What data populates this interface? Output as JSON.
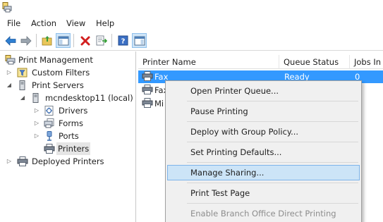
{
  "window": {
    "app_icon": "printer-management-icon"
  },
  "menubar": {
    "items": [
      "File",
      "Action",
      "View",
      "Help"
    ]
  },
  "toolbar": {
    "buttons": [
      "back-icon",
      "forward-icon",
      "up-folder-icon",
      "show-hide-console-tree-icon",
      "delete-icon",
      "export-list-icon",
      "help-icon",
      "show-hide-action-pane-icon"
    ]
  },
  "tree": {
    "root": "Print Management",
    "custom_filters": "Custom Filters",
    "print_servers": "Print Servers",
    "server": "mcndesktop11 (local)",
    "drivers": "Drivers",
    "forms": "Forms",
    "ports": "Ports",
    "printers": "Printers",
    "deployed_printers": "Deployed Printers"
  },
  "list": {
    "columns": [
      "Printer Name",
      "Queue Status",
      "Jobs In"
    ],
    "rows": [
      {
        "name": "Fax",
        "status": "Ready",
        "jobs": "0"
      },
      {
        "name": "Fax",
        "status": "",
        "jobs": ""
      },
      {
        "name": "Mi",
        "status": "",
        "jobs": ""
      }
    ]
  },
  "context_menu": {
    "items": [
      "Open Printer Queue...",
      "Pause Printing",
      "Deploy with Group Policy...",
      "Set Printing Defaults...",
      "Manage Sharing...",
      "Print Test Page",
      "Enable Branch Office Direct Printing"
    ]
  },
  "colors": {
    "selection": "#3399ff",
    "menu_hover": "#cce4f7",
    "menu_hover_border": "#7eb4ea"
  }
}
